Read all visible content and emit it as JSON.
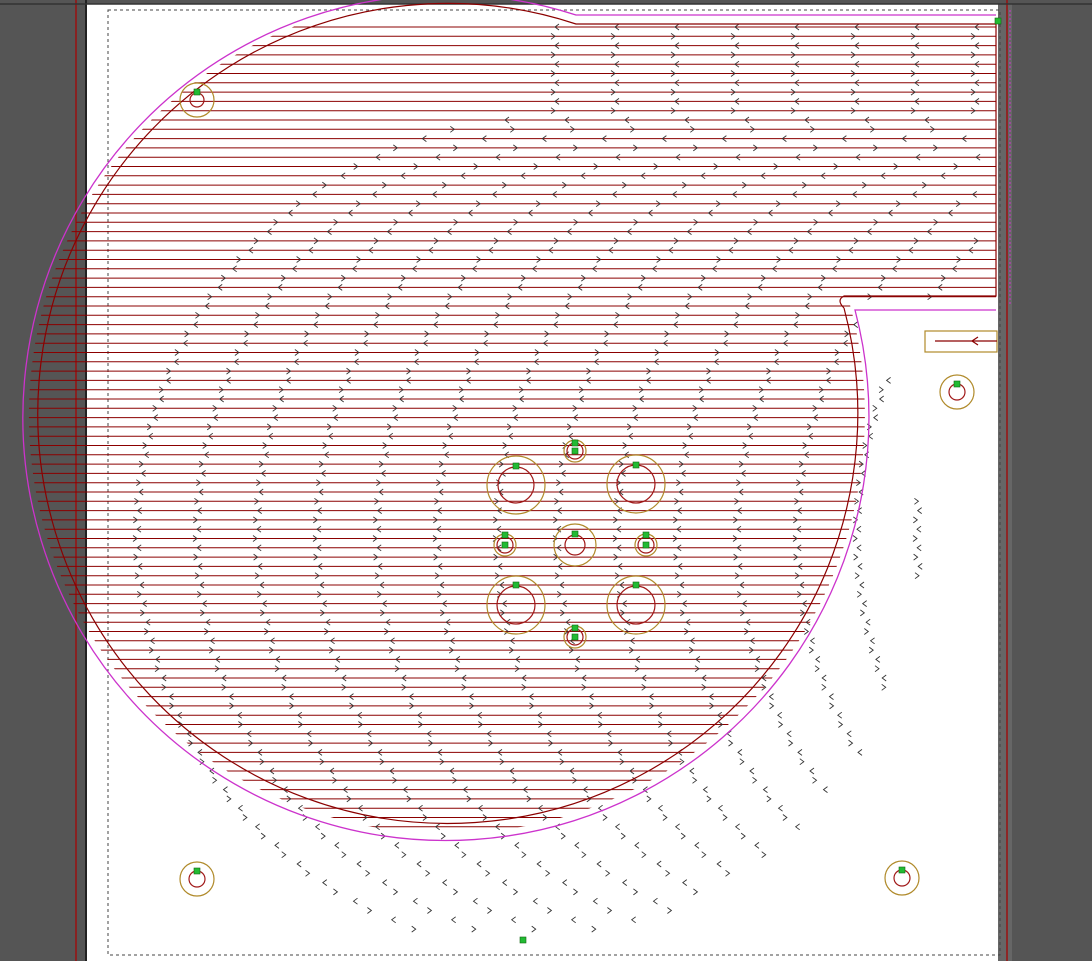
{
  "colors": {
    "background": "#555555",
    "sheet": "#ffffff",
    "path": "#8b0000",
    "outline": "#cc33cc",
    "hole_ring": "#b08a2a",
    "hole_path": "#a01818",
    "marker": "#22bb33",
    "margin": "#444444",
    "rail": "#9a1010"
  },
  "icons": {
    "start_marker": "square-marker-icon",
    "direction": "arrow-chevron-icon",
    "lead_in": "lead-in-arrow-icon"
  }
}
